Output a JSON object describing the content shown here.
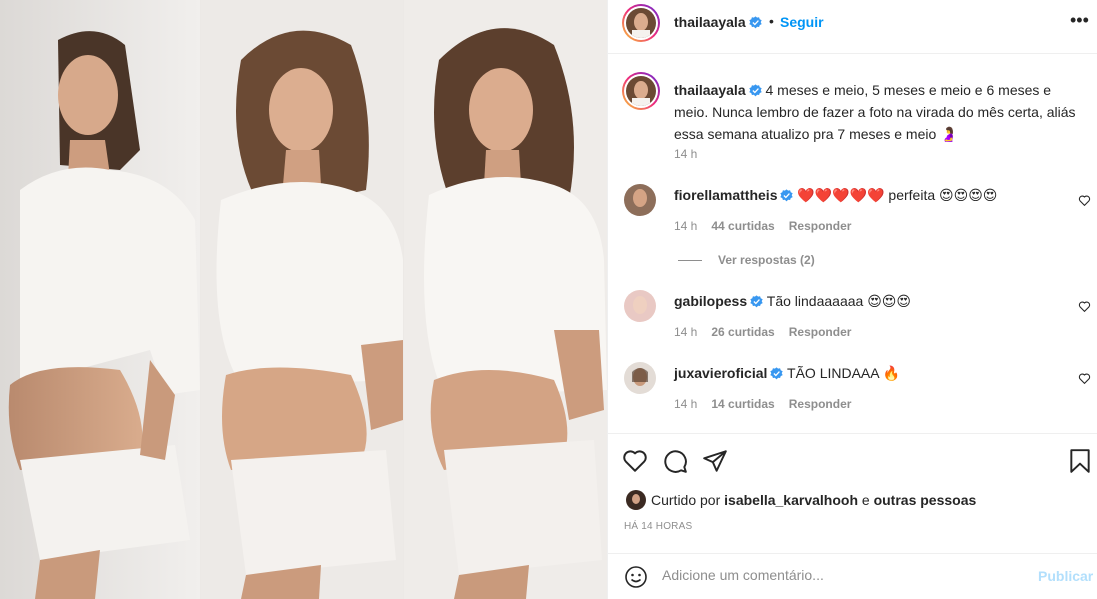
{
  "post": {
    "username": "thailaayala",
    "follow_label": "Seguir",
    "separator": "•",
    "more_icon": "more-horizontal-icon",
    "caption": "4 meses e meio, 5 meses e meio e 6 meses e meio. Nunca lembro de fazer a foto na virada do mês certa, aliás essa semana atualizo pra 7 meses e meio 🤰",
    "caption_time": "14 h"
  },
  "comments": [
    {
      "username": "fiorellamattheis",
      "text": "❤️❤️❤️❤️❤️ perfeita 😍😍😍😍",
      "time": "14 h",
      "likes": "44 curtidas",
      "reply": "Responder"
    },
    {
      "username": "gabilopess",
      "text": "Tão lindaaaaaa 😍😍😍",
      "time": "14 h",
      "likes": "26 curtidas",
      "reply": "Responder"
    },
    {
      "username": "juxavieroficial",
      "text": "TÃO LINDAAA 🔥",
      "time": "14 h",
      "likes": "14 curtidas",
      "reply": "Responder"
    }
  ],
  "view_replies": "Ver respostas (2)",
  "likes": {
    "prefix": "Curtido por",
    "user": "isabella_karvalhooh",
    "conj": "e",
    "rest": "outras pessoas"
  },
  "posted_ago": "HÁ 14 HORAS",
  "add_comment": {
    "placeholder": "Adicione um comentário...",
    "publish": "Publicar"
  },
  "colors": {
    "link": "#0095f6",
    "muted": "#8e8e8e",
    "text": "#262626",
    "publish_disabled": "#b2dffc",
    "border": "#efefef"
  }
}
